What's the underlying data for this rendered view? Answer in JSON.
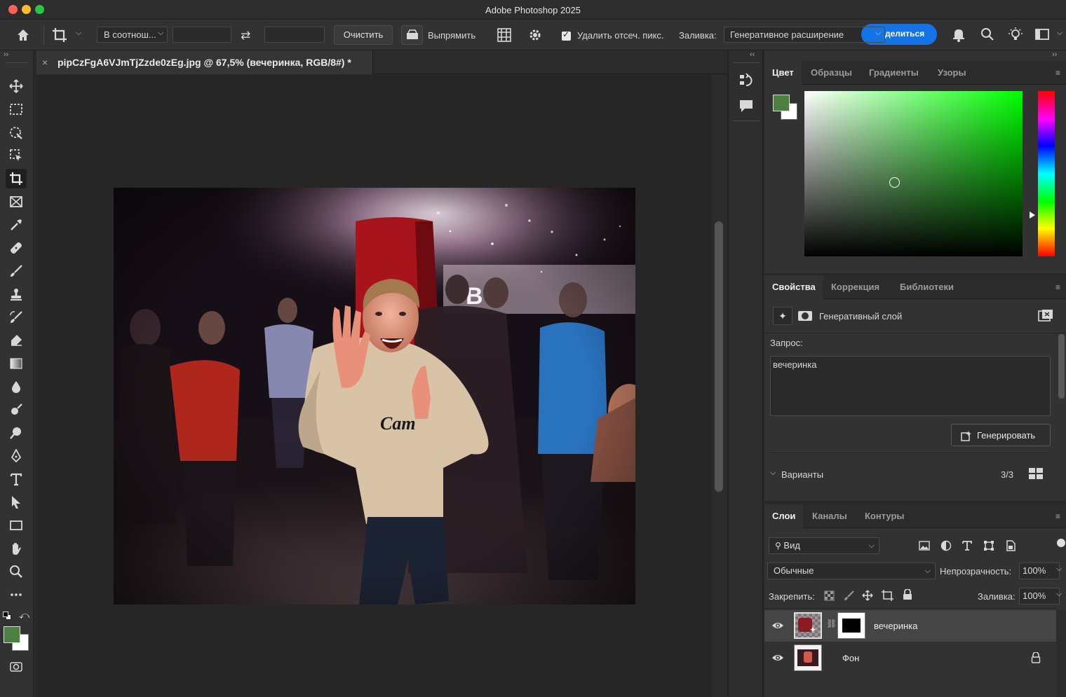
{
  "app": {
    "title": "Adobe Photoshop 2025"
  },
  "colors": {
    "accent": "#1473e6",
    "fg_swatch": "#4c8041",
    "bg_swatch": "#ffffff",
    "picker_hue": "#00ff00"
  },
  "options_bar": {
    "ratio_label": "В соотнош...",
    "clear_label": "Очистить",
    "straighten_label": "Выпрямить",
    "delete_cropped_label": "Удалить отсеч. пикс.",
    "fill_label": "Заливка:",
    "fill_value": "Генеративное расширение",
    "share_label": "делиться"
  },
  "document": {
    "tab_title": "pipCzFgA6VJmTjZzde0zEg.jpg @ 67,5% (вечеринка, RGB/8#) *"
  },
  "color_panel": {
    "tabs": [
      "Цвет",
      "Образцы",
      "Градиенты",
      "Узоры"
    ]
  },
  "properties_panel": {
    "tabs": [
      "Свойства",
      "Коррекция",
      "Библиотеки"
    ],
    "layer_type": "Генеративный слой",
    "prompt_label": "Запрос:",
    "prompt_value": "вечеринка",
    "generate_label": "Генерировать",
    "variants_label": "Варианты",
    "variants_count": "3/3"
  },
  "layers_panel": {
    "tabs": [
      "Слои",
      "Каналы",
      "Контуры"
    ],
    "filter_label": "Вид",
    "blend_mode": "Обычные",
    "opacity_label": "Непрозрачность:",
    "opacity_value": "100%",
    "lock_label": "Закрепить:",
    "fill_label": "Заливка:",
    "fill_value": "100%",
    "layers": [
      {
        "name": "вечеринка",
        "selected": true
      },
      {
        "name": "Фон",
        "locked": true
      }
    ]
  }
}
